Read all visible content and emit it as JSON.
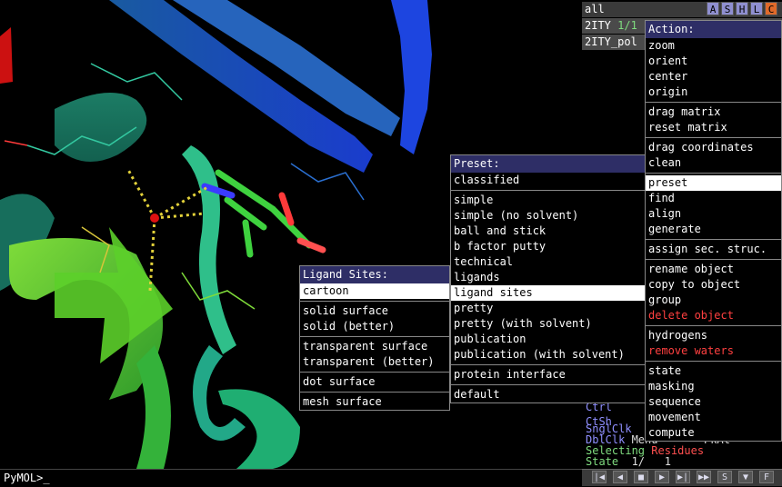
{
  "viewer": {
    "command_prompt": "PyMOL>_"
  },
  "object_panel": {
    "all_label": "all",
    "ashlc_buttons": [
      "A",
      "S",
      "H",
      "L",
      "C"
    ],
    "objects": [
      {
        "name": "2ITY",
        "counter": "1/1"
      },
      {
        "name": "2ITY_pol"
      }
    ]
  },
  "help_panel": {
    "lines": [
      {
        "a": "Ctrl",
        "b": " "
      },
      {
        "a": "CtSh",
        "b": " "
      },
      {
        "a": "SnglClk",
        "b": " "
      },
      {
        "a": "DblClk",
        "b": " Menu   -   PkAt"
      }
    ],
    "selecting_label": "Selecting",
    "selecting_value": "Residues",
    "state_label": "State",
    "state_value": "1/   1"
  },
  "vcr_buttons": [
    "|◀",
    "◀",
    "■",
    "▶",
    "▶|",
    "▶▶",
    "S",
    "▼",
    "F"
  ],
  "action_menu": {
    "title": "Action:",
    "groups": [
      [
        {
          "label": "zoom"
        },
        {
          "label": "orient"
        },
        {
          "label": "center"
        },
        {
          "label": "origin"
        }
      ],
      [
        {
          "label": "drag matrix"
        },
        {
          "label": "reset matrix"
        }
      ],
      [
        {
          "label": "drag coordinates"
        },
        {
          "label": "clean"
        }
      ],
      [
        {
          "label": "preset",
          "selected": true
        },
        {
          "label": "find"
        },
        {
          "label": "align"
        },
        {
          "label": "generate"
        }
      ],
      [
        {
          "label": "assign sec. struc."
        }
      ],
      [
        {
          "label": "rename object"
        },
        {
          "label": "copy to object"
        },
        {
          "label": "group"
        },
        {
          "label": "delete object",
          "danger": true
        }
      ],
      [
        {
          "label": "hydrogens"
        },
        {
          "label": "remove waters",
          "danger": true
        }
      ],
      [
        {
          "label": "state"
        },
        {
          "label": "masking"
        },
        {
          "label": "sequence"
        },
        {
          "label": "movement"
        },
        {
          "label": "compute"
        }
      ]
    ]
  },
  "preset_menu": {
    "title": "Preset:",
    "groups": [
      [
        {
          "label": "classified"
        }
      ],
      [
        {
          "label": "simple"
        },
        {
          "label": "simple (no solvent)"
        },
        {
          "label": "ball and stick"
        },
        {
          "label": "b factor putty"
        },
        {
          "label": "technical"
        },
        {
          "label": "ligands"
        },
        {
          "label": "ligand sites",
          "selected": true
        },
        {
          "label": "pretty"
        },
        {
          "label": "pretty (with solvent)"
        },
        {
          "label": "publication"
        },
        {
          "label": "publication (with solvent)"
        }
      ],
      [
        {
          "label": "protein interface"
        }
      ],
      [
        {
          "label": "default"
        }
      ]
    ]
  },
  "ligand_menu": {
    "title": "Ligand Sites:",
    "groups": [
      [
        {
          "label": "cartoon",
          "selected": true
        }
      ],
      [
        {
          "label": "solid surface"
        },
        {
          "label": "solid (better)"
        }
      ],
      [
        {
          "label": "transparent surface"
        },
        {
          "label": "transparent (better)"
        }
      ],
      [
        {
          "label": "dot surface"
        }
      ],
      [
        {
          "label": "mesh surface"
        }
      ]
    ]
  }
}
